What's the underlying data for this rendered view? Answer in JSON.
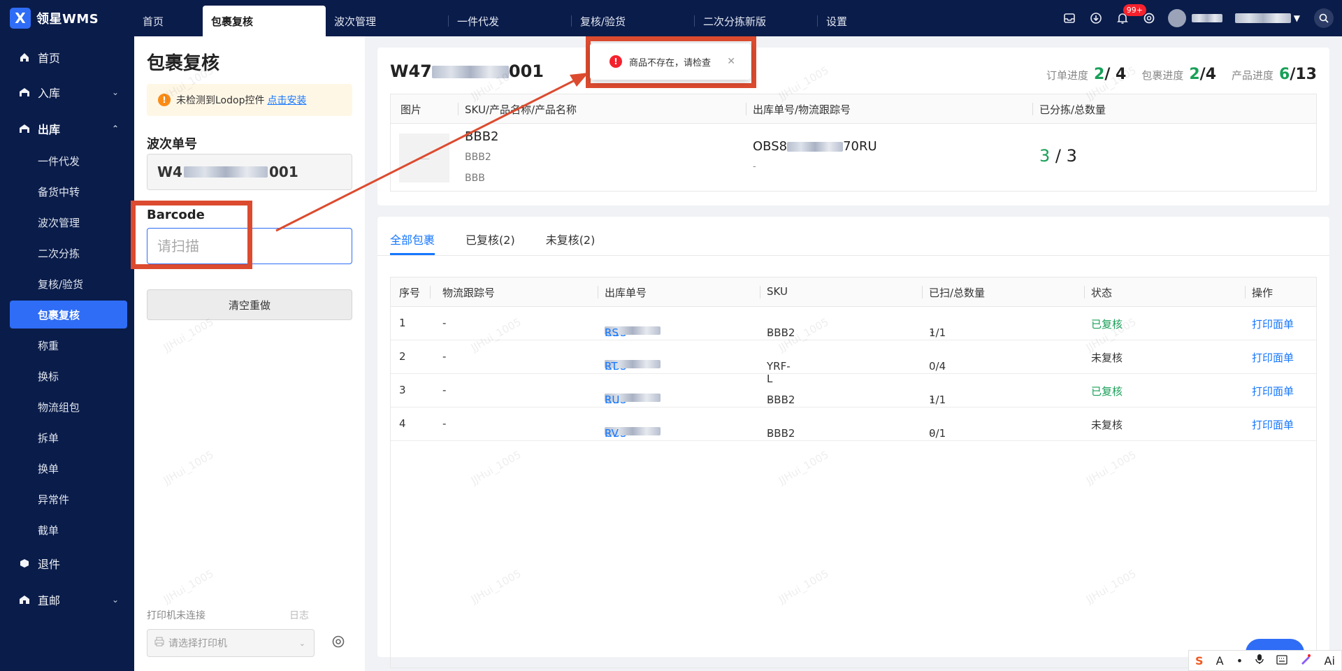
{
  "app": {
    "name": "领星WMS",
    "logo_glyph": "X"
  },
  "topnav": {
    "items": [
      "首页",
      "包裹复核",
      "波次管理",
      "一件代发",
      "复核/验货",
      "二次分拣新版",
      "设置"
    ],
    "active_index": 1
  },
  "header_icons": {
    "items": [
      "inbox-icon",
      "download-icon",
      "bell-icon",
      "settings-icon"
    ],
    "notification_badge": "99+"
  },
  "sidebar": {
    "groups": [
      {
        "label": "首页",
        "icon": "home-icon"
      },
      {
        "label": "入库",
        "icon": "inbound-icon",
        "expanded": false
      },
      {
        "label": "出库",
        "icon": "outbound-icon",
        "expanded": true
      },
      {
        "label": "退件",
        "icon": "return-icon"
      },
      {
        "label": "直邮",
        "icon": "direct-mail-icon",
        "expanded": false
      }
    ],
    "outbound_items": [
      "一件代发",
      "备货中转",
      "波次管理",
      "二次分拣",
      "复核/验货",
      "包裹复核",
      "称重",
      "换标",
      "物流组包",
      "拆单",
      "换单",
      "异常件",
      "截单"
    ],
    "active_item": "包裹复核"
  },
  "left_panel": {
    "title": "包裹复核",
    "warning": {
      "text": "未检测到Lodop控件",
      "link": "点击安装"
    },
    "wave_label": "波次单号",
    "wave_value_prefix": "W4",
    "wave_value_suffix": "001",
    "barcode_label": "Barcode",
    "barcode_placeholder": "请扫描",
    "clear_button": "清空重做",
    "printer_status": "打印机未连接",
    "log_label": "日志",
    "printer_placeholder": "请选择打印机"
  },
  "summary": {
    "wave_code_prefix": "W47",
    "wave_code_suffix": "001",
    "order_progress": {
      "label": "订单进度",
      "done": "2",
      "total": "/ 4"
    },
    "package_progress": {
      "label": "包裹进度",
      "done": "2",
      "total": "/4"
    },
    "product_progress": {
      "label": "产品进度",
      "done": "6",
      "total": "/13"
    },
    "columns": [
      "图片",
      "SKU/产品名称/产品名称",
      "出库单号/物流跟踪号",
      "已分拣/总数量"
    ],
    "row": {
      "sku": "BBB2",
      "name1": "BBB2",
      "name2": "BBB",
      "outbound_prefix": "OBS8",
      "outbound_suffix": "70RU",
      "tracking": "-",
      "sorted": "3",
      "total": "/ 3"
    }
  },
  "tabs": [
    "全部包裹",
    "已复核(2)",
    "未复核(2)"
  ],
  "packages": {
    "columns": [
      "序号",
      "物流跟踪号",
      "出库单号",
      "SKU",
      "已扫/总数量",
      "状态",
      "操作"
    ],
    "rows": [
      {
        "no": "1",
        "tracking": "-",
        "ob_prefix": "OBS",
        "ob_suffix": "RS",
        "sku": "BBB2",
        "sku_dropdown": true,
        "scanned": "1/1",
        "scan_dropdown": true,
        "status": "已复核",
        "status_ok": true,
        "action": "打印面单"
      },
      {
        "no": "2",
        "tracking": "-",
        "ob_prefix": "OBS",
        "ob_suffix": "RT",
        "sku": "YRF-L",
        "sku_dropdown": false,
        "scanned": "0/4",
        "scan_dropdown": false,
        "status": "未复核",
        "status_ok": false,
        "action": "打印面单"
      },
      {
        "no": "3",
        "tracking": "-",
        "ob_prefix": "OBS",
        "ob_suffix": "RU",
        "sku": "BBB2",
        "sku_dropdown": true,
        "scanned": "1/1",
        "scan_dropdown": true,
        "status": "已复核",
        "status_ok": true,
        "action": "打印面单"
      },
      {
        "no": "4",
        "tracking": "-",
        "ob_prefix": "OBS",
        "ob_suffix": "RV",
        "sku": "BBB2",
        "sku_dropdown": true,
        "scanned": "0/1",
        "scan_dropdown": true,
        "status": "未复核",
        "status_ok": false,
        "action": "打印面单"
      }
    ]
  },
  "toast": {
    "message": "商品不存在，请检查",
    "icon": "error-icon"
  },
  "ime_toolbar": {
    "items": [
      "S",
      "A",
      "•",
      "mic-icon",
      "keyboard-icon",
      "skin-icon",
      "Ai"
    ]
  },
  "watermark": "JJHui_1005",
  "colors": {
    "nav_bg": "#0a1c4a",
    "accent": "#2f6df6",
    "success": "#18a058",
    "link": "#1677ff",
    "annotation_red": "#dc4b2f"
  }
}
